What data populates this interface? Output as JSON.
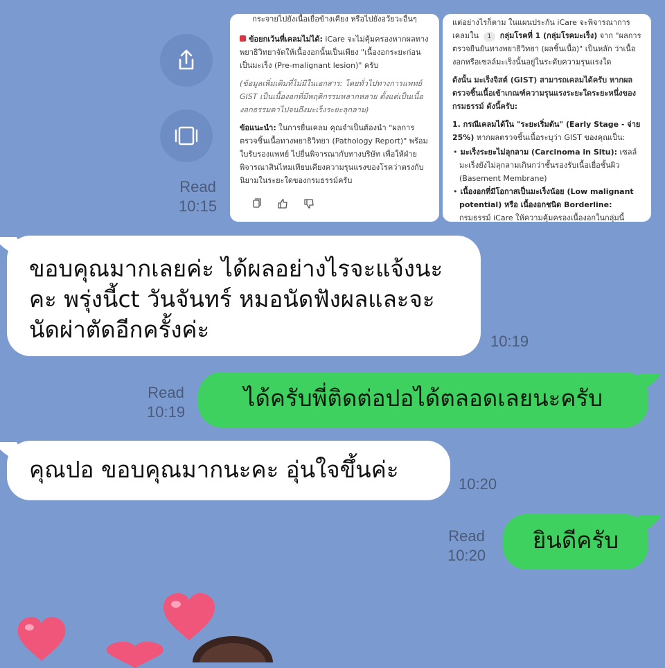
{
  "shared_message": {
    "card_left": {
      "line_top": "กระจายไปยังเนื้อเยื่อข้างเคียง หรือไปยังอวัยวะอื่นๆ",
      "exception_title": "ข้อยกเว้นที่เคลมไม่ได้:",
      "exception_body": "iCare จะไม่คุ้มครองหากผลทางพยาธิวิทยาจัดให้เนื้องอกนั้นเป็นเพียง \"เนื้องอกระยะก่อนเป็นมะเร็ง (Pre-malignant lesion)\" ครับ",
      "note": "(ข้อมูลเพิ่มเติมที่ไม่มีในเอกสาร: โดยทั่วไปทางการแพทย์ GIST เป็นเนื้องอกที่มีพฤติกรรมหลากหลาย ตั้งแต่เป็นเนื้องอกธรรมดาไปจนถึงมะเร็งระยะลุกลาม)",
      "advice_title": "ข้อแนะนำ:",
      "advice_body": "ในการยื่นเคลม คุณจำเป็นต้องนำ \"ผลการตรวจชิ้นเนื้อทางพยาธิวิทยา (Pathology Report)\" พร้อมใบรับรองแพทย์ ไปยื่นพิจารณากับทางบริษัท เพื่อให้ฝ่ายพิจารณาสินไหมเทียบเคียงความรุนแรงของโรคว่าตรงกับนิยามในระยะใดของกรมธรรม์ครับ"
    },
    "card_right": {
      "line1": "แต่อย่างไรก็ตาม ในแผนประกัน iCare จะพิจารณาการเคลมใน",
      "chip": "1",
      "group": "กลุ่มโรคที่ 1 (กลุ่มโรคมะเร็ง)",
      "line2": "จาก \"ผลการตรวจยืนยันทางพยาธิวิทยา (ผลชิ้นเนื้อ)\" เป็นหลัก ว่าเนื้องอกหรือเซลล์มะเร็งนั้นอยู่ในระดับความรุนแรงใด",
      "line3": "ดังนั้น มะเร็งจิสต์ (GIST) สามารถเคลมได้ครับ หากผลตรวจชิ้นเนื้อเข้าเกณฑ์ความรุนแรงระยะใดระยะหนึ่งของกรมธรรม์ ดังนี้ครับ:",
      "item1_title": "1. กรณีเคลมได้ใน \"ระยะเริ่มต้น\" (Early Stage - จ่าย 25%)",
      "item1_body": "หากผลตรวจชิ้นเนื้อระบุว่า GIST ของคุณเป็น:",
      "bullet1_title": "มะเร็งระยะไม่ลุกลาม (Carcinoma in Situ):",
      "bullet1_body": "เซลล์มะเร็งยังไม่ลุกลามเกินกว่าชั้นรองรับเนื้อเยื่อชั้นผิว (Basement Membrane)",
      "bullet2_title": "เนื้องอกที่มีโอกาสเป็นมะเร็งน้อย (Low malignant potential) หรือ เนื้องอกชนิด Borderline:",
      "bullet2_body": "กรมธรรม์ iCare ให้ความคุ้มครองเนื้องอกในกลุ่มนี้"
    },
    "read_label": "Read",
    "read_time": "10:15"
  },
  "messages": [
    {
      "from": "them",
      "text": "ขอบคุณมากเลยค่ะ  ได้ผลอย่างไรจะแจ้งนะคะ  พรุ่งนี้ct วันจันทร์ หมอนัดฟังผลและจะนัดผ่าตัดอีกครั้งค่ะ",
      "time": "10:19"
    },
    {
      "from": "me",
      "text": "ได้ครับพี่ติดต่อปอได้ตลอดเลยนะครับ",
      "read_label": "Read",
      "time": "10:19"
    },
    {
      "from": "them",
      "text": "คุณปอ ขอบคุณมากนะคะ อุ่นใจขึ้นค่ะ",
      "time": "10:20"
    },
    {
      "from": "me",
      "text": "ยินดีครับ",
      "read_label": "Read",
      "time": "10:20"
    }
  ],
  "icons": {
    "share": "share-icon",
    "screenshot": "screenshot-icon",
    "copy": "copy-icon",
    "like": "thumbs-up-icon",
    "dislike": "thumbs-down-icon"
  },
  "colors": {
    "background": "#7b9bd0",
    "bubble_incoming": "#ffffff",
    "bubble_outgoing": "#3ed160",
    "heart": "#f0557a"
  }
}
